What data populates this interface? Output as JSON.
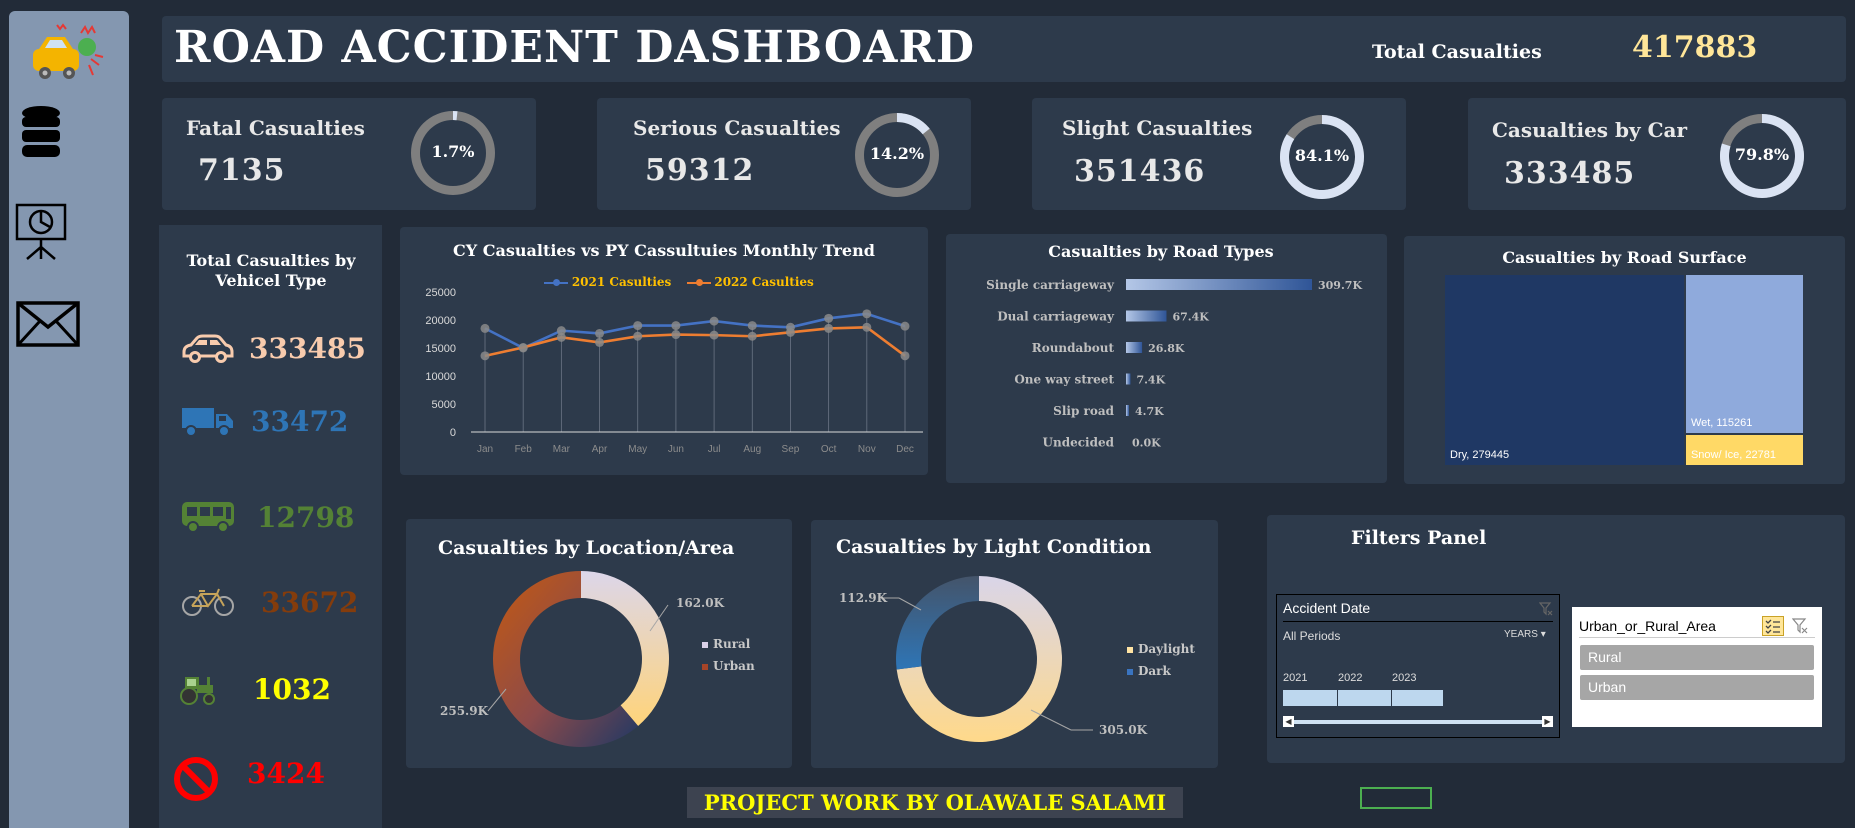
{
  "header": {
    "title": "ROAD ACCIDENT DASHBOARD",
    "total_label": "Total Casualties",
    "total_value": "417883"
  },
  "sidebar": {
    "items": [
      {
        "icon": "car-crash-icon"
      },
      {
        "icon": "database-icon"
      },
      {
        "icon": "presentation-icon"
      },
      {
        "icon": "mail-icon"
      }
    ]
  },
  "kpis": [
    {
      "label": "Fatal Casualties",
      "value": "7135",
      "pct_label": "1.7%",
      "pct": 1.7
    },
    {
      "label": "Serious Casualties",
      "value": "59312",
      "pct_label": "14.2%",
      "pct": 14.2
    },
    {
      "label": "Slight Casualties",
      "value": "351436",
      "pct_label": "84.1%",
      "pct": 84.1
    },
    {
      "label": "Casualties by Car",
      "value": "333485",
      "pct_label": "79.8%",
      "pct": 79.8
    }
  ],
  "vehicle_panel": {
    "title": "Total Casualties by Vehicel Type",
    "items": [
      {
        "icon": "car-icon",
        "value": "333485",
        "color": "#f8cbad"
      },
      {
        "icon": "truck-icon",
        "value": "33472",
        "color": "#2e75b6"
      },
      {
        "icon": "bus-icon",
        "value": "12798",
        "color": "#548235"
      },
      {
        "icon": "bicycle-icon",
        "value": "33672",
        "color": "#843c0c"
      },
      {
        "icon": "tractor-icon",
        "value": "1032",
        "color": "#ffff00"
      },
      {
        "icon": "no-entry-icon",
        "value": "3424",
        "color": "#ff0000"
      }
    ]
  },
  "chart_data": [
    {
      "type": "line",
      "title": "CY Casualties vs PY Cassultuies Monthly Trend",
      "categories": [
        "Jan",
        "Feb",
        "Mar",
        "Apr",
        "May",
        "Jun",
        "Jul",
        "Aug",
        "Sep",
        "Oct",
        "Nov",
        "Dec"
      ],
      "series": [
        {
          "name": "2021 Casulties",
          "color": "#4472c4",
          "values": [
            18500,
            15000,
            18100,
            17600,
            19000,
            19000,
            19800,
            19000,
            18700,
            20300,
            21100,
            18900
          ]
        },
        {
          "name": "2022 Casulties",
          "color": "#ed7d31",
          "values": [
            13600,
            15100,
            16900,
            16000,
            17100,
            17400,
            17300,
            17100,
            17800,
            18500,
            18700,
            13600
          ]
        }
      ],
      "ylim": [
        0,
        25000
      ],
      "yticks": [
        "0",
        "5000",
        "10000",
        "15000",
        "20000",
        "25000"
      ],
      "grid": false,
      "legend": "top"
    },
    {
      "type": "bar",
      "title": "Casualties by Road Types",
      "categories": [
        "Single carriageway",
        "Dual carriageway",
        "Roundabout",
        "One way street",
        "Slip road",
        "Undecided"
      ],
      "values": [
        309.7,
        67.4,
        26.8,
        7.4,
        4.7,
        0.0
      ],
      "labels": [
        "309.7K",
        "67.4K",
        "26.8K",
        "7.4K",
        "4.7K",
        "0.0K"
      ]
    },
    {
      "type": "treemap",
      "title": "Casualties by Road Surface",
      "items": [
        {
          "name": "Dry",
          "value": 279445,
          "label": "Dry, 279445",
          "color": "#1f3864"
        },
        {
          "name": "Wet",
          "value": 115261,
          "label": "Wet, 115261",
          "color": "#8faadc"
        },
        {
          "name": "Snow/ Ice",
          "value": 22781,
          "label": "Snow/ Ice, 22781",
          "color": "#ffd966"
        }
      ]
    },
    {
      "type": "pie",
      "title": "Casualties by Location/Area",
      "items": [
        {
          "name": "Rural",
          "value": 162.0,
          "label": "162.0K"
        },
        {
          "name": "Urban",
          "value": 255.9,
          "label": "255.9K"
        }
      ],
      "legend": "right"
    },
    {
      "type": "pie",
      "title": "Casualties by Light Condition",
      "items": [
        {
          "name": "Daylight",
          "value": 305.0,
          "label": "305.0K"
        },
        {
          "name": "Dark",
          "value": 112.9,
          "label": "112.9K"
        }
      ],
      "legend": "right"
    }
  ],
  "filters": {
    "title": "Filters Panel",
    "date_slicer": {
      "header": "Accident Date",
      "periods": "All Periods",
      "level": "YEARS",
      "years": [
        "2021",
        "2022",
        "2023"
      ]
    },
    "area_slicer": {
      "header": "Urban_or_Rural_Area",
      "options": [
        "Rural",
        "Urban"
      ]
    }
  },
  "footer": {
    "credit": "PROJECT WORK BY OLAWALE SALAMI"
  }
}
